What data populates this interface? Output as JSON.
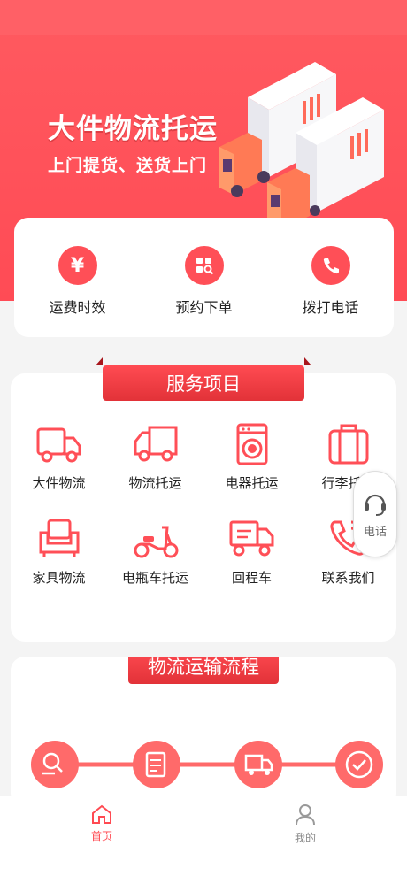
{
  "hero": {
    "title": "大件物流托运",
    "subtitle": "上门提货、送货上门"
  },
  "quick_actions": [
    {
      "label": "运费时效",
      "icon": "yen-icon"
    },
    {
      "label": "预约下单",
      "icon": "grid-search-icon"
    },
    {
      "label": "拨打电话",
      "icon": "phone-icon"
    }
  ],
  "services": {
    "title": "服务项目",
    "items": [
      {
        "label": "大件物流",
        "icon": "truck-icon"
      },
      {
        "label": "物流托运",
        "icon": "van-icon"
      },
      {
        "label": "电器托运",
        "icon": "washing-machine-icon"
      },
      {
        "label": "行李托运",
        "icon": "luggage-icon"
      },
      {
        "label": "家具物流",
        "icon": "sofa-icon"
      },
      {
        "label": "电瓶车托运",
        "icon": "scooter-icon"
      },
      {
        "label": "回程车",
        "icon": "return-truck-icon"
      },
      {
        "label": "联系我们",
        "icon": "phone-ring-icon"
      }
    ]
  },
  "float_call": {
    "label": "电话",
    "icon": "headset-icon"
  },
  "process": {
    "title": "物流运输流程",
    "steps": [
      {
        "icon": "search-list-icon"
      },
      {
        "icon": "document-icon"
      },
      {
        "icon": "delivery-truck-icon"
      },
      {
        "icon": "check-icon"
      }
    ]
  },
  "tabbar": {
    "home": {
      "label": "首页"
    },
    "mine": {
      "label": "我的"
    }
  },
  "colors": {
    "brand": "#ff4f57",
    "dark_red": "#e23238"
  }
}
